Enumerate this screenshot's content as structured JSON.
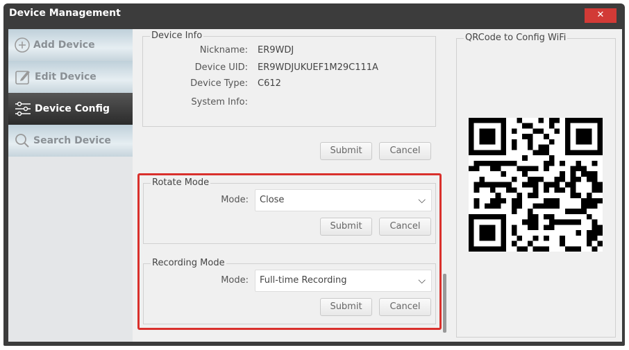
{
  "window": {
    "title": "Device Management",
    "close": "✕"
  },
  "sidebar": {
    "items": [
      {
        "label": "Add Device"
      },
      {
        "label": "Edit Device"
      },
      {
        "label": "Device Config"
      },
      {
        "label": "Search Device"
      }
    ]
  },
  "device_info": {
    "legend": "Device Info",
    "nickname_label": "Nickname:",
    "nickname": "ER9WDJ",
    "uid_label": "Device UID:",
    "uid": "ER9WDJUKUEF1M29C111A",
    "type_label": "Device Type:",
    "type": "C612",
    "sysinfo_label": "System Info:",
    "submit": "Submit",
    "cancel": "Cancel"
  },
  "rotate": {
    "legend": "Rotate Mode",
    "mode_label": "Mode:",
    "mode": "Close",
    "submit": "Submit",
    "cancel": "Cancel"
  },
  "recording": {
    "legend": "Recording Mode",
    "mode_label": "Mode:",
    "mode": "Full-time Recording",
    "submit": "Submit",
    "cancel": "Cancel"
  },
  "qr": {
    "legend": "QRCode to Config WiFi"
  }
}
